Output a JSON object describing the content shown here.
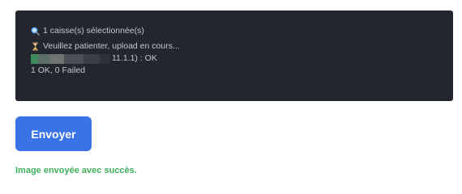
{
  "log": {
    "lines": [
      {
        "icon": "magnifier-icon",
        "text": "1 caisse(s) sélectionnée(s)"
      },
      {
        "icon": "hourglass-icon",
        "text": "Veuillez patienter, upload en cours..."
      },
      {
        "icon": "redacted-block",
        "text": "11.1.1) : OK"
      },
      {
        "icon": null,
        "text": "1 OK, 0 Failed"
      }
    ]
  },
  "actions": {
    "send_label": "Envoyer"
  },
  "status": {
    "message": "Image envoyée avec succès."
  },
  "colors": {
    "console_bg": "#23252f",
    "console_text": "#c4c7cf",
    "button_bg": "#3a73e6",
    "success_text": "#3fae5c"
  }
}
